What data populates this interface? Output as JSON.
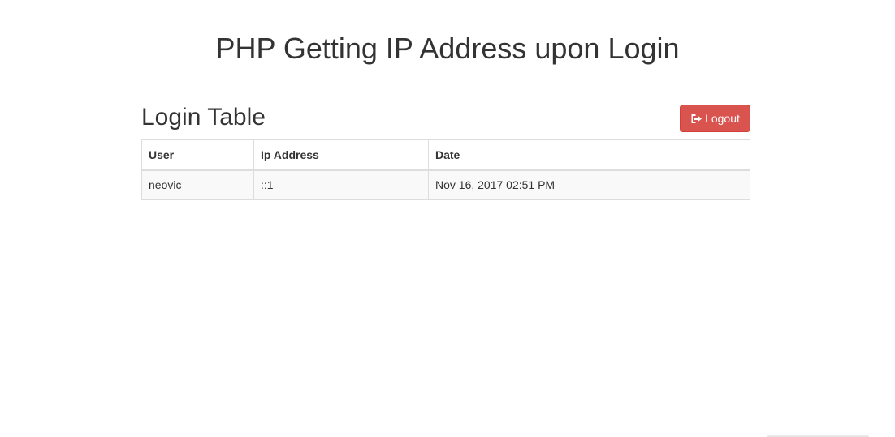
{
  "header": {
    "title": "PHP Getting IP Address upon Login"
  },
  "main": {
    "section_title": "Login Table",
    "logout": {
      "label": "Logout",
      "icon": "sign-out-icon",
      "color": "#d9534f"
    },
    "table": {
      "columns": [
        "User",
        "Ip Address",
        "Date"
      ],
      "rows": [
        [
          "neovic",
          "::1",
          "Nov 16, 2017 02:51 PM"
        ]
      ]
    }
  }
}
